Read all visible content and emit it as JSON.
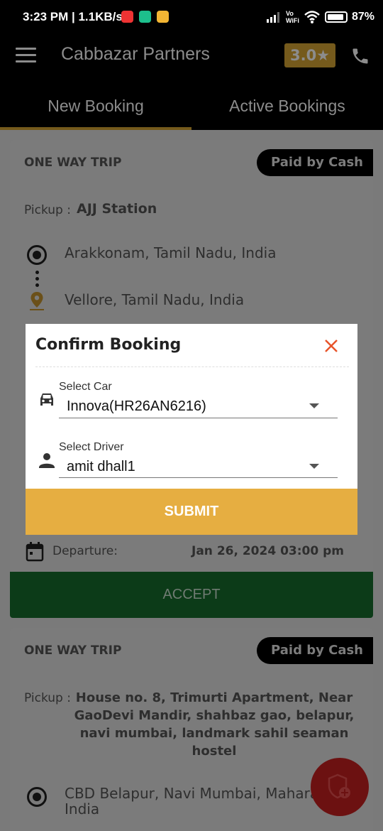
{
  "status_bar": {
    "time_speed": "3:23 PM | 1.1KB/s",
    "vowifi": "Vo WiFi",
    "battery": "87%"
  },
  "app_bar": {
    "title": "Cabbazar Partners",
    "rating": "3.0★",
    "icons": [
      "hamburger-menu-icon",
      "phone-icon"
    ]
  },
  "tabs": [
    {
      "label": "New Booking",
      "active": true
    },
    {
      "label": "Active Bookings",
      "active": false
    }
  ],
  "booking1": {
    "trip_type": "ONE WAY TRIP",
    "payment": "Paid by Cash",
    "pickup_label": "Pickup :",
    "pickup_value": "AJJ Station",
    "from": "Arakkonam, Tamil Nadu, India",
    "to": "Vellore, Tamil Nadu, India",
    "departure_label": "Departure:",
    "departure_value": "Jan 26, 2024 03:00 pm",
    "accept_label": "ACCEPT"
  },
  "booking2": {
    "trip_type": "ONE WAY TRIP",
    "payment": "Paid by Cash",
    "pickup_label": "Pickup :",
    "pickup_lines": [
      "House no. 8, Trimurti Apartment, Near",
      "GaoDevi Mandir, shahbaz gao, belapur,",
      "navi mumbai, landmark sahil seaman",
      "hostel"
    ],
    "from_lines": [
      "CBD Belapur, Navi Mumbai, Maharas",
      "India"
    ]
  },
  "dialog": {
    "title": "Confirm Booking",
    "car_label": "Select Car",
    "car_value": "Innova(HR26AN6216)",
    "driver_label": "Select Driver",
    "driver_value": "amit dhall1",
    "submit_label": "SUBMIT"
  },
  "colors": {
    "accent_gold": "#e6ae41",
    "close_orange": "#e8542a",
    "accept_green": "#0c3b18",
    "fab_red": "#6c1111"
  }
}
